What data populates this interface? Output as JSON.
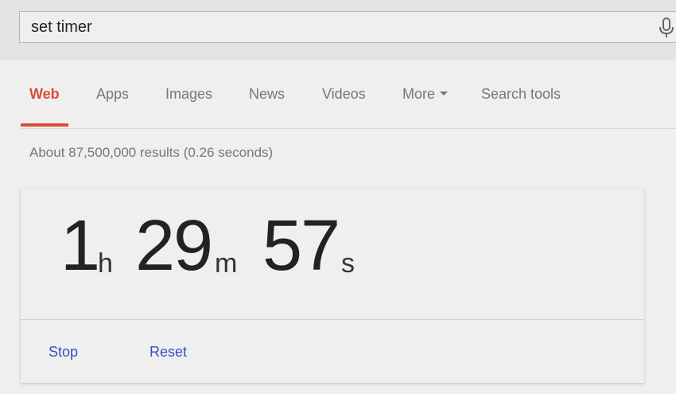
{
  "search": {
    "query": "set timer"
  },
  "icons": {
    "mic": "microphone-icon",
    "more_caret": "caret-down-icon"
  },
  "nav": {
    "tabs": [
      {
        "label": "Web",
        "active": true
      },
      {
        "label": "Apps",
        "active": false
      },
      {
        "label": "Images",
        "active": false
      },
      {
        "label": "News",
        "active": false
      },
      {
        "label": "Videos",
        "active": false
      },
      {
        "label": "More",
        "active": false
      },
      {
        "label": "Search tools",
        "active": false
      }
    ]
  },
  "results": {
    "stats": "About 87,500,000 results (0.26 seconds)"
  },
  "timer": {
    "hours": "1",
    "hours_unit": "h",
    "minutes": "29",
    "minutes_unit": "m",
    "seconds": "57",
    "seconds_unit": "s",
    "stop_label": "Stop",
    "reset_label": "Reset"
  },
  "colors": {
    "accent_active_tab": "#dd4b39",
    "link": "#3b4ec0",
    "background": "#efefef"
  }
}
